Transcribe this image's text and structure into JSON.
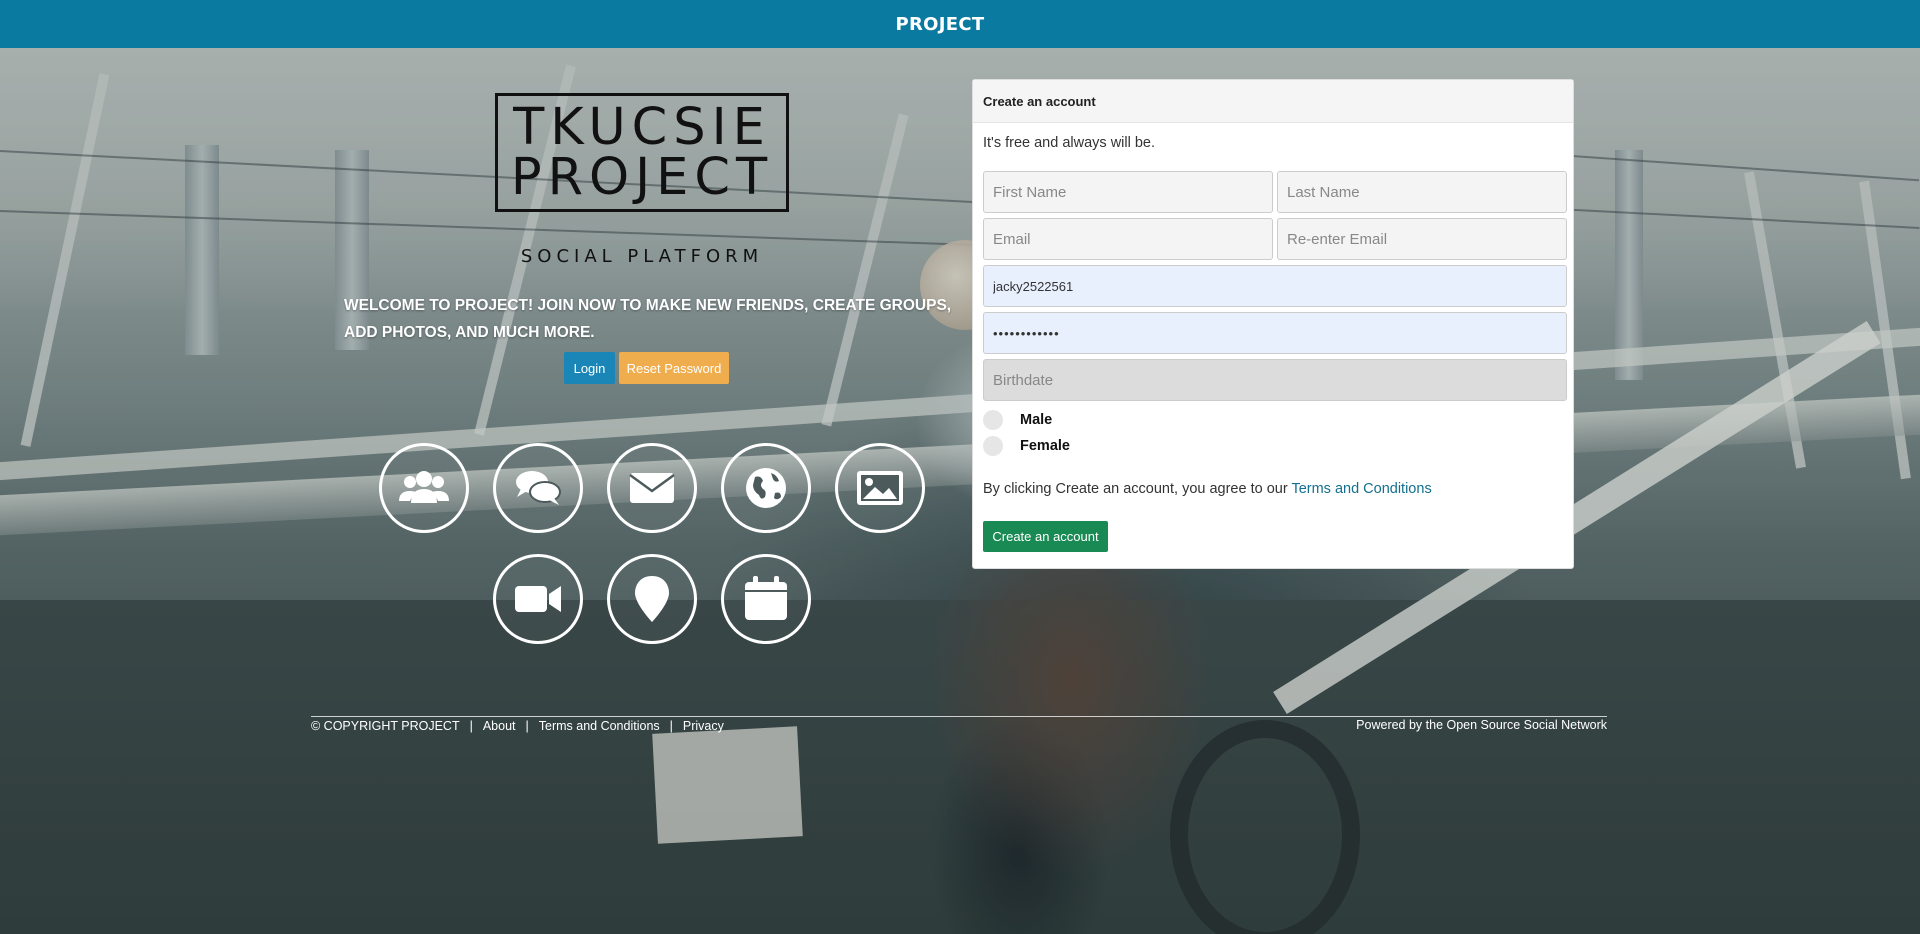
{
  "topbar": {
    "brand": "PROJECT"
  },
  "logo": {
    "line1": "TKUCSIE",
    "line2": "PROJECT",
    "tagline": "SOCIAL PLATFORM"
  },
  "welcome": {
    "text": "WELCOME TO PROJECT! JOIN NOW TO MAKE NEW FRIENDS, CREATE GROUPS, ADD PHOTOS, AND MUCH MORE."
  },
  "buttons": {
    "login": "Login",
    "reset": "Reset Password"
  },
  "features": [
    "users-icon",
    "chat-icon",
    "mail-icon",
    "globe-icon",
    "image-icon",
    "video-icon",
    "location-icon",
    "calendar-icon"
  ],
  "signup": {
    "title": "Create an account",
    "subtitle": "It's free and always will be.",
    "first_name_placeholder": "First Name",
    "last_name_placeholder": "Last Name",
    "email_placeholder": "Email",
    "reemail_placeholder": "Re-enter Email",
    "username_value": "jacky2522561",
    "password_value": "••••••••••••",
    "birthdate_placeholder": "Birthdate",
    "gender_male": "Male",
    "gender_female": "Female",
    "terms_prefix": "By clicking Create an account, you agree to our",
    "terms_link": "Terms and Conditions",
    "submit": "Create an account"
  },
  "footer": {
    "copyright": "© COPYRIGHT PROJECT",
    "sep": "|",
    "links": [
      "About",
      "Terms and Conditions",
      "Privacy"
    ],
    "powered": "Powered by the Open Source Social Network"
  },
  "colors": {
    "topbar": "#0b7aa1",
    "login_button": "#1a86b7",
    "reset_button": "#f0ad4e",
    "create_button": "#1a8a54",
    "terms_link": "#13708f"
  }
}
